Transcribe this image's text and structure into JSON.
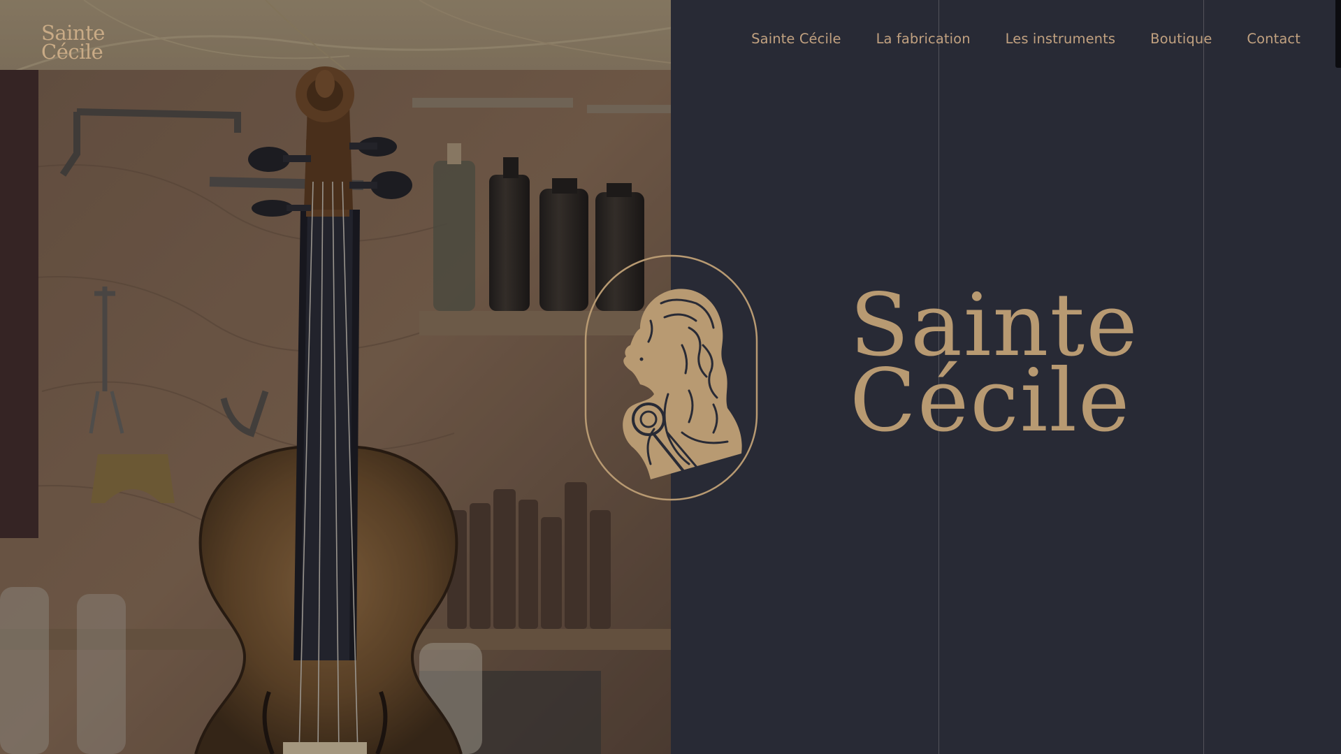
{
  "brand": {
    "logo_line1": "Sainte",
    "logo_line2": "Cécile"
  },
  "nav": {
    "items": [
      {
        "label": "Sainte Cécile"
      },
      {
        "label": "La fabrication"
      },
      {
        "label": "Les instruments"
      },
      {
        "label": "Boutique"
      },
      {
        "label": "Contact"
      }
    ]
  },
  "hero": {
    "title_line1": "Sainte",
    "title_line2": "Cécile",
    "emblem": "saint-cecilia-portrait-icon"
  },
  "photo": {
    "subject": "violin-workshop-photo"
  },
  "colors": {
    "background": "#282a35",
    "accent": "#b89a72",
    "nav_text": "#c1a180",
    "guide_line": "#53535a"
  }
}
